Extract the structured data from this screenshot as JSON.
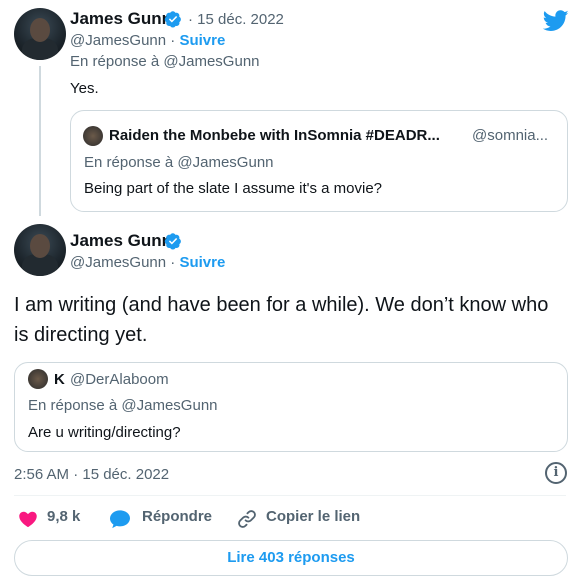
{
  "colors": {
    "accent": "#1d9bf0",
    "muted": "#536471",
    "heart": "#f91880",
    "border": "#cfd9de"
  },
  "first_tweet": {
    "author_name": "James Gunn",
    "date": "· 15 déc. 2022",
    "handle": "@JamesGunn",
    "separator": "·",
    "follow": "Suivre",
    "reply_to": "En réponse à @JamesGunn",
    "text": "Yes.",
    "quote": {
      "author_name": "Raiden the Monbebe with InSomnia #DEADR...",
      "handle": "@somnia...",
      "reply_to": "En réponse à @JamesGunn",
      "text": "Being part of the slate I assume it's a movie?"
    }
  },
  "main_tweet": {
    "author_name": "James Gunn",
    "handle": "@JamesGunn",
    "separator": "·",
    "follow": "Suivre",
    "text": "I am writing (and have been for a while). We don’t know who is directing yet.",
    "quote": {
      "author_name": "K",
      "handle": "@DerAlaboom",
      "reply_to": "En réponse à @JamesGunn",
      "text": "Are u writing/directing?"
    },
    "timestamp": "2:56 AM · 15 déc. 2022",
    "info_icon": "i"
  },
  "actions": {
    "likes": "9,8 k",
    "reply": "Répondre",
    "copy_link": "Copier le lien"
  },
  "replies_button": "Lire 403 réponses",
  "icons": [
    "twitter-logo-icon",
    "verified-badge-icon",
    "heart-icon",
    "reply-bubble-icon",
    "link-icon",
    "info-icon"
  ]
}
